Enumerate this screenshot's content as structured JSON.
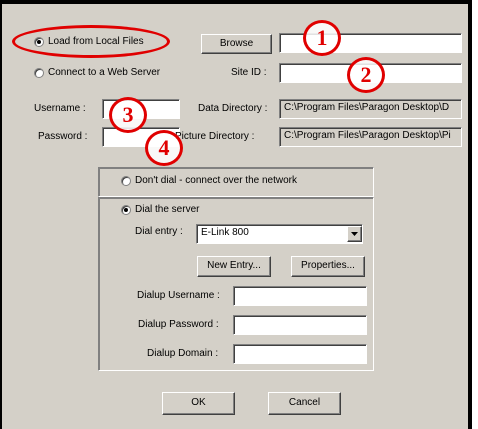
{
  "source": {
    "load_local_label": "Load from Local Files",
    "connect_web_label": "Connect to a Web Server",
    "browse_label": "Browse",
    "site_id_label": "Site ID :",
    "local_path_value": "",
    "site_id_value": ""
  },
  "login": {
    "username_label": "Username :",
    "password_label": "Password :",
    "username_value": "",
    "password_value": ""
  },
  "directories": {
    "data_label": "Data Directory :",
    "data_value": "C:\\Program Files\\Paragon Desktop\\D",
    "picture_label": "Picture Directory :",
    "picture_value": "C:\\Program Files\\Paragon Desktop\\Pi"
  },
  "network": {
    "dont_dial_label": "Don't dial - connect over the network",
    "dial_server_label": "Dial the server",
    "dial_entry_label": "Dial entry :",
    "dial_entry_value": "E-Link 800",
    "new_entry_label": "New Entry...",
    "properties_label": "Properties...",
    "dialup_username_label": "Dialup Username :",
    "dialup_password_label": "Dialup Password :",
    "dialup_domain_label": "Dialup Domain :"
  },
  "footer": {
    "ok_label": "OK",
    "cancel_label": "Cancel"
  },
  "annotations": {
    "callout_1": "1",
    "callout_2": "2",
    "callout_3": "3",
    "callout_4": "4",
    "color": "#e00000"
  }
}
